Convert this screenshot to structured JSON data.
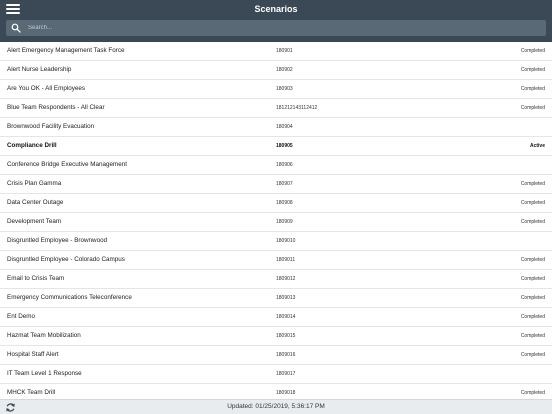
{
  "header": {
    "title": "Scenarios"
  },
  "search": {
    "placeholder": "Search..."
  },
  "scenarios": [
    {
      "name": "Alert Emergency Management Task Force",
      "code": "180901",
      "status": "Completed",
      "active": false
    },
    {
      "name": "Alert Nurse Leadership",
      "code": "180902",
      "status": "Completed",
      "active": false
    },
    {
      "name": "Are You OK - All Employees",
      "code": "180903",
      "status": "Completed",
      "active": false
    },
    {
      "name": "Blue Team Respondents - All Clear",
      "code": "181212143112412",
      "status": "Completed",
      "active": false
    },
    {
      "name": "Brownwood Facility Evacuation",
      "code": "180904",
      "status": "",
      "active": false
    },
    {
      "name": "Compliance Drill",
      "code": "180905",
      "status": "Active",
      "active": true
    },
    {
      "name": "Conference Bridge Executive Management",
      "code": "180906",
      "status": "",
      "active": false
    },
    {
      "name": "Crisis Plan Gamma",
      "code": "180907",
      "status": "Completed",
      "active": false
    },
    {
      "name": "Data Center Outage",
      "code": "180908",
      "status": "Completed",
      "active": false
    },
    {
      "name": "Development Team",
      "code": "180909",
      "status": "Completed",
      "active": false
    },
    {
      "name": "Disgruntled Employee - Brownwood",
      "code": "1809010",
      "status": "",
      "active": false
    },
    {
      "name": "Disgruntled Employee - Colorado Campus",
      "code": "1809011",
      "status": "Completed",
      "active": false
    },
    {
      "name": "Email to Crisis Team",
      "code": "1809012",
      "status": "Completed",
      "active": false
    },
    {
      "name": "Emergency Communications Teleconference",
      "code": "1809013",
      "status": "Completed",
      "active": false
    },
    {
      "name": "Ent Demo",
      "code": "1809014",
      "status": "Completed",
      "active": false
    },
    {
      "name": "Hazmat Team Mobilization",
      "code": "1809015",
      "status": "Completed",
      "active": false
    },
    {
      "name": "Hospital Staff Alert",
      "code": "1809016",
      "status": "Completed",
      "active": false
    },
    {
      "name": "IT Team Level 1 Response",
      "code": "1809017",
      "status": "",
      "active": false
    },
    {
      "name": "MHCK Team Drill",
      "code": "1809018",
      "status": "Completed",
      "active": false
    }
  ],
  "footer": {
    "updated": "Updated: 01/25/2019, 5:36:17 PM"
  },
  "icons": {
    "menu": "hamburger-menu-icon",
    "search": "search-icon",
    "refresh": "refresh-icon"
  },
  "colors": {
    "header_bg": "#3a4955",
    "search_bg": "#596975",
    "footer_bg": "#e9ecee"
  }
}
